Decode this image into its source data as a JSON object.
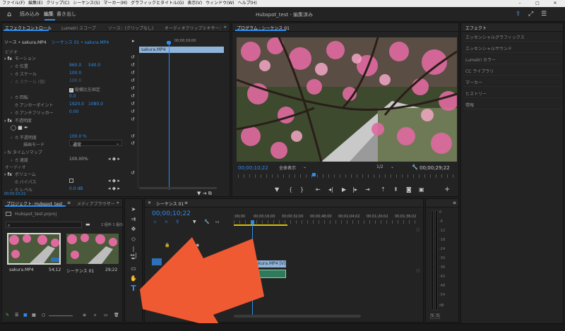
{
  "menubar": [
    "ファイル(F)",
    "編集(E)",
    "クリップ(C)",
    "シーケンス(S)",
    "マーカー(M)",
    "グラフィックとタイトル(G)",
    "表示(V)",
    "ウィンドウ(W)",
    "ヘルプ(H)"
  ],
  "titlebar": {
    "workspaces": [
      "読み込み",
      "編集",
      "書き出し"
    ],
    "project_title": "Hubspot_test - 編集済み"
  },
  "effect_controls": {
    "tabs": [
      "エフェクトコントロール",
      "Lumetri スコープ",
      "ソース：(クリップなし)",
      "オーディオクリップミキサー："
    ],
    "source_label": "ソース • sakura.MP4",
    "sequence_label": "シーケンス 01 • sakura.MP4",
    "clip_name": "sakura.MP4",
    "time_marker": "00;00;16;00",
    "video_header": "ビデオ",
    "motion": "モーション",
    "position_label": "位置",
    "position_x": "960.0",
    "position_y": "540.0",
    "scale_label": "スケール",
    "scale_value": "100.0",
    "scale_width_label": "スケール (幅)",
    "scale_width_value": "100.0",
    "uniform_scale": "縦横比を固定",
    "rotation_label": "回転",
    "rotation_value": "0.0",
    "anchor_label": "アンカーポイント",
    "anchor_x": "1920.0",
    "anchor_y": "1080.0",
    "flicker_label": "アンチフリッカー",
    "flicker_value": "0.00",
    "opacity_header": "不透明度",
    "opacity_label": "不透明度",
    "opacity_value": "100.0 %",
    "blend_label": "描画モード",
    "blend_value": "通常",
    "time_remap": "タイムリマップ",
    "speed_label": "速度",
    "speed_value": "100.00%",
    "audio_header": "オーディオ",
    "volume": "ボリューム",
    "bypass_label": "バイパス",
    "level_label": "レベル",
    "level_value": "0.0 dB",
    "current_time": "00;00;10;22"
  },
  "program_monitor": {
    "tab": "プログラム : シーケンス 01",
    "timecode": "00;00;10;22",
    "zoom": "全体表示",
    "resolution": "1/2",
    "duration": "00;00;29;22"
  },
  "effects_panel": {
    "title": "エフェクト",
    "items": [
      "エッセンシャルグラフィックス",
      "エッセンシャルサウンド",
      "Lumetri カラー",
      "CC ライブラリ",
      "マーカー",
      "ヒストリー",
      "情報"
    ]
  },
  "project_panel": {
    "tabs": [
      "プロジェクト: Hubspot_test",
      "メディアブラウザー"
    ],
    "project_file": "Hubspot_test.prproj",
    "item_count": "2 個中 1 個の",
    "items": [
      {
        "name": "sakura.MP4",
        "duration": "54;12"
      },
      {
        "name": "シーケンス 01",
        "duration": "29;22"
      }
    ]
  },
  "timeline": {
    "tab": "シーケンス 01",
    "timecode": "00;00;10;22",
    "ruler": [
      ";00;00",
      "00;00;16;00",
      "00;00;32;00",
      "00;00;48;00",
      "00;01;04;02",
      "00;01;20;02",
      "00;01;36;02"
    ],
    "clip_video": "sakura.MP4 [V]"
  },
  "audio_meter": {
    "scale": [
      "0",
      "-6",
      "-12",
      "-18",
      "-24",
      "-30",
      "-36",
      "-42",
      "-48",
      "-54",
      "dB"
    ],
    "solo": [
      "S",
      "S"
    ]
  },
  "colors": {
    "accent": "#2d8ceb",
    "arrow": "#f05a32",
    "clip": "#8fb3d9"
  }
}
